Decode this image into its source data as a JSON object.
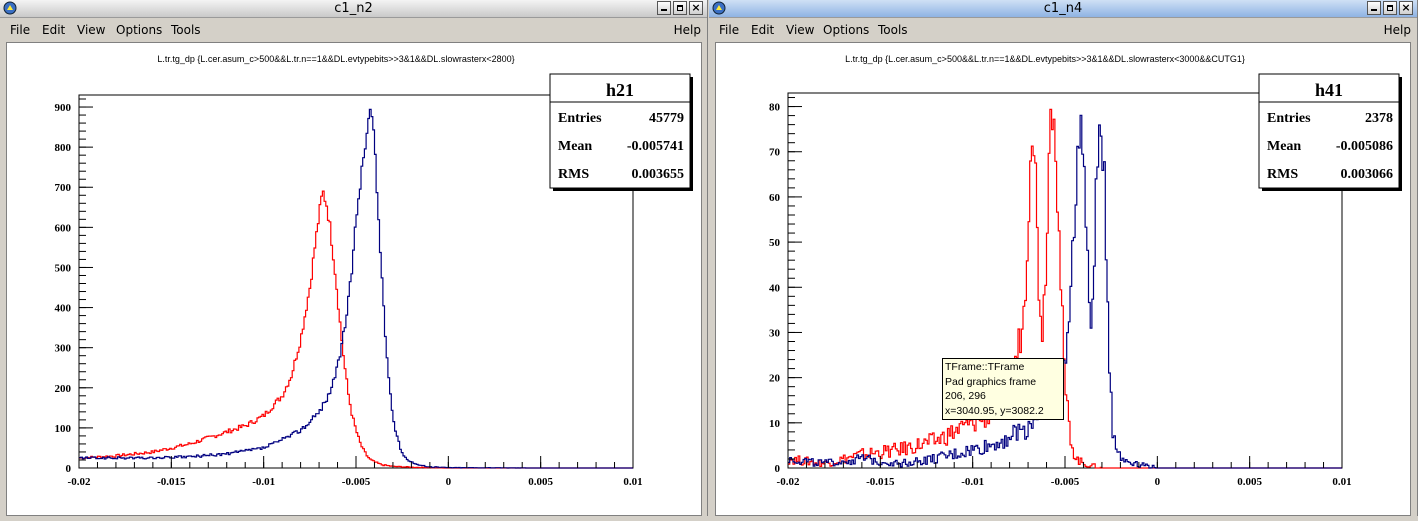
{
  "windows": [
    {
      "title": "c1_n2",
      "active": false,
      "menu": [
        "File",
        "Edit",
        "View",
        "Options",
        "Tools"
      ],
      "help": "Help"
    },
    {
      "title": "c1_n4",
      "active": true,
      "menu": [
        "File",
        "Edit",
        "View",
        "Options",
        "Tools"
      ],
      "help": "Help"
    }
  ],
  "colors": {
    "red": "#ff0000",
    "blue": "#000080",
    "axis": "#000000"
  },
  "chart_data": [
    {
      "type": "line",
      "title": "L.tr.tg_dp {L.cer.asum_c>500&&L.tr.n==1&&DL.evtypebits>>3&1&&DL.slowrasterx<2800}",
      "xlim": [
        -0.02,
        0.01
      ],
      "ylim": [
        0,
        930
      ],
      "x_ticks": [
        "-0.02",
        "-0.015",
        "-0.01",
        "-0.005",
        "0",
        "0.005",
        "0.01"
      ],
      "y_ticks": [
        "0",
        "100",
        "200",
        "300",
        "400",
        "500",
        "600",
        "700",
        "800",
        "900"
      ],
      "stats": {
        "name": "h21",
        "entries_label": "Entries",
        "entries": "45779",
        "mean_label": "Mean",
        "mean": "-0.005741",
        "rms_label": "RMS",
        "rms": "0.003655"
      },
      "series": [
        {
          "color": "red",
          "x": [
            -0.02,
            -0.018,
            -0.016,
            -0.014,
            -0.012,
            -0.011,
            -0.01,
            -0.009,
            -0.0085,
            -0.008,
            -0.0075,
            -0.0072,
            -0.007,
            -0.0068,
            -0.0066,
            -0.0064,
            -0.0062,
            -0.006,
            -0.0058,
            -0.0056,
            -0.0054,
            -0.0052,
            -0.005,
            -0.0048,
            -0.0046,
            -0.0044,
            -0.0042,
            -0.004,
            -0.0036,
            -0.003,
            -0.002,
            -0.001,
            0,
            0.005,
            0.01
          ],
          "y": [
            25,
            30,
            40,
            60,
            90,
            105,
            130,
            180,
            230,
            320,
            450,
            560,
            630,
            690,
            660,
            600,
            520,
            430,
            330,
            250,
            180,
            130,
            95,
            65,
            45,
            30,
            20,
            15,
            8,
            4,
            2,
            1,
            0,
            0,
            0
          ]
        },
        {
          "color": "blue",
          "x": [
            -0.02,
            -0.018,
            -0.016,
            -0.014,
            -0.012,
            -0.01,
            -0.009,
            -0.008,
            -0.0075,
            -0.007,
            -0.0065,
            -0.006,
            -0.0055,
            -0.0052,
            -0.005,
            -0.0048,
            -0.0046,
            -0.0044,
            -0.0043,
            -0.0042,
            -0.0041,
            -0.004,
            -0.0039,
            -0.0038,
            -0.0036,
            -0.0034,
            -0.0032,
            -0.003,
            -0.0028,
            -0.0026,
            -0.0024,
            -0.002,
            -0.0015,
            -0.001,
            0,
            0.005,
            0.01
          ],
          "y": [
            25,
            25,
            25,
            28,
            35,
            50,
            70,
            95,
            115,
            140,
            180,
            250,
            380,
            500,
            620,
            700,
            770,
            840,
            880,
            890,
            870,
            810,
            720,
            640,
            480,
            330,
            200,
            130,
            80,
            50,
            30,
            15,
            6,
            3,
            1,
            0,
            0
          ]
        }
      ]
    },
    {
      "type": "line",
      "title": "L.tr.tg_dp {L.cer.asum_c>500&&L.tr.n==1&&DL.evtypebits>>3&1&&DL.slowrasterx<3000&&CUTG1}",
      "xlim": [
        -0.02,
        0.01
      ],
      "ylim": [
        0,
        83
      ],
      "x_ticks": [
        "-0.02",
        "-0.015",
        "-0.01",
        "-0.005",
        "0",
        "0.005",
        "0.01"
      ],
      "y_ticks": [
        "0",
        "10",
        "20",
        "30",
        "40",
        "50",
        "60",
        "70",
        "80"
      ],
      "stats": {
        "name": "h41",
        "entries_label": "Entries",
        "entries": "2378",
        "mean_label": "Mean",
        "mean": "-0.005086",
        "rms_label": "RMS",
        "rms": "0.003066"
      },
      "series": [
        {
          "color": "red",
          "x": [
            -0.02,
            -0.018,
            -0.016,
            -0.014,
            -0.012,
            -0.011,
            -0.01,
            -0.009,
            -0.0085,
            -0.008,
            -0.0076,
            -0.0072,
            -0.007,
            -0.0068,
            -0.0066,
            -0.0064,
            -0.0062,
            -0.006,
            -0.0058,
            -0.0056,
            -0.0054,
            -0.0052,
            -0.005,
            -0.0048,
            -0.0046,
            -0.0044,
            -0.004,
            -0.003,
            0,
            0.01
          ],
          "y": [
            2,
            1,
            3,
            4,
            6,
            8,
            10,
            12,
            15,
            20,
            25,
            35,
            55,
            80,
            65,
            40,
            30,
            50,
            78,
            85,
            60,
            38,
            18,
            10,
            5,
            2,
            1,
            0,
            0,
            0
          ]
        },
        {
          "color": "blue",
          "x": [
            -0.02,
            -0.018,
            -0.016,
            -0.014,
            -0.012,
            -0.01,
            -0.009,
            -0.008,
            -0.007,
            -0.0065,
            -0.006,
            -0.0055,
            -0.005,
            -0.0048,
            -0.0046,
            -0.0044,
            -0.0042,
            -0.004,
            -0.0038,
            -0.0036,
            -0.0034,
            -0.0032,
            -0.003,
            -0.0028,
            -0.0026,
            -0.0024,
            -0.002,
            -0.001,
            0,
            0.01
          ],
          "y": [
            2,
            1,
            2,
            1,
            2,
            4,
            5,
            7,
            9,
            12,
            14,
            16,
            22,
            35,
            45,
            60,
            79,
            70,
            45,
            30,
            50,
            70,
            77,
            55,
            25,
            8,
            2,
            1,
            0,
            0
          ]
        }
      ]
    }
  ],
  "tooltip": [
    "TFrame::TFrame",
    "Pad graphics frame",
    "206, 296",
    "x=3040.95, y=3082.2"
  ]
}
